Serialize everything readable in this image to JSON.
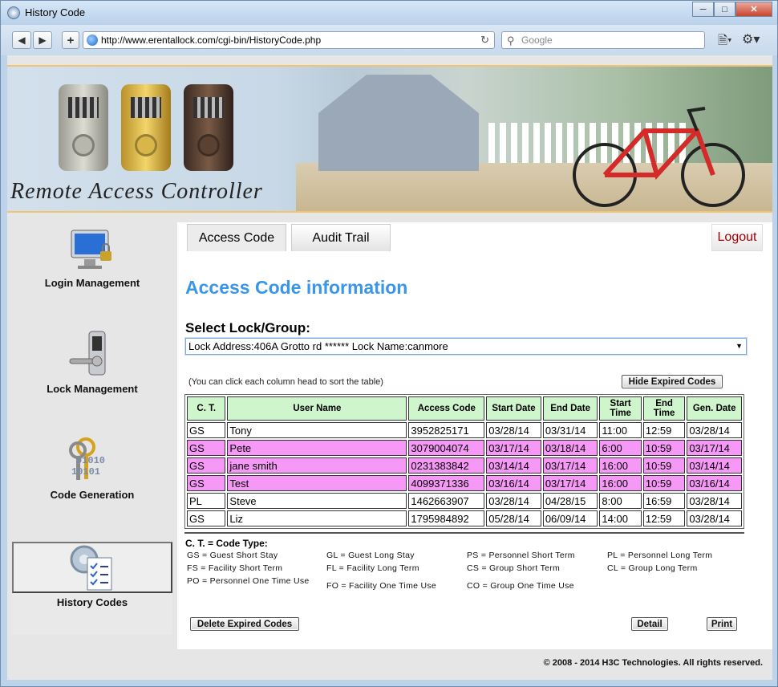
{
  "window": {
    "title": "History Code"
  },
  "browser": {
    "url": "http://www.erentallock.com/cgi-bin/HistoryCode.php",
    "search_placeholder": "Google"
  },
  "banner": {
    "logo_text": "Remote Access Controller"
  },
  "sidebar": {
    "items": [
      {
        "label": "Login Management"
      },
      {
        "label": "Lock Management"
      },
      {
        "label": "Code Generation"
      },
      {
        "label": "History Codes"
      }
    ],
    "code_icon_digits": [
      "01010",
      "10101"
    ]
  },
  "tabs": {
    "access": "Access Code",
    "audit": "Audit Trail",
    "logout": "Logout"
  },
  "page": {
    "heading": "Access Code information",
    "select_label": "Select Lock/Group:",
    "select_value": "Lock Address:406A Grotto rd ****** Lock Name:canmore",
    "hint": "(You can click each column head to sort the table)",
    "hide_expired": "Hide Expired Codes"
  },
  "table": {
    "headers": [
      "C. T.",
      "User Name",
      "Access Code",
      "Start Date",
      "End Date",
      "Start Time",
      "End Time",
      "Gen. Date"
    ],
    "rows": [
      [
        "GS",
        "Tony",
        "3952825171",
        "03/28/14",
        "03/31/14",
        "11:00",
        "12:59",
        "03/28/14"
      ],
      [
        "GS",
        "Pete",
        "3079004074",
        "03/17/14",
        "03/18/14",
        "6:00",
        "10:59",
        "03/17/14"
      ],
      [
        "GS",
        "jane smith",
        "0231383842",
        "03/14/14",
        "03/17/14",
        "16:00",
        "10:59",
        "03/14/14"
      ],
      [
        "GS",
        "Test",
        "4099371336",
        "03/16/14",
        "03/17/14",
        "16:00",
        "10:59",
        "03/16/14"
      ],
      [
        "PL",
        "Steve",
        "1462663907",
        "03/28/14",
        "04/28/15",
        "8:00",
        "16:59",
        "03/28/14"
      ],
      [
        "GS",
        "Liz",
        "1795984892",
        "05/28/14",
        "06/09/14",
        "14:00",
        "12:59",
        "03/28/14"
      ]
    ]
  },
  "legend": {
    "title": "C. T. = Code Type:",
    "items": [
      "GS = Guest Short Stay",
      "GL = Guest Long Stay",
      "PS = Personnel Short Term",
      "PL = Personnel Long Term",
      "FS = Facility Short Term",
      "FL = Facility Long Term",
      "CS = Group Short Term",
      "CL = Group Long Term",
      "PO = Personnel One Time Use",
      "FO = Facility One Time Use",
      "CO = Group One Time Use"
    ]
  },
  "actions": {
    "delete_expired": "Delete Expired Codes",
    "detail": "Detail",
    "print": "Print"
  },
  "footer": {
    "copyright": "© 2008 - 2014 H3C Technologies. All rights reserved."
  },
  "colors": {
    "heading": "#3a96e6",
    "header_bg": "#cff5cc",
    "highlight_row": "#f698f6",
    "logout": "#a00000"
  }
}
